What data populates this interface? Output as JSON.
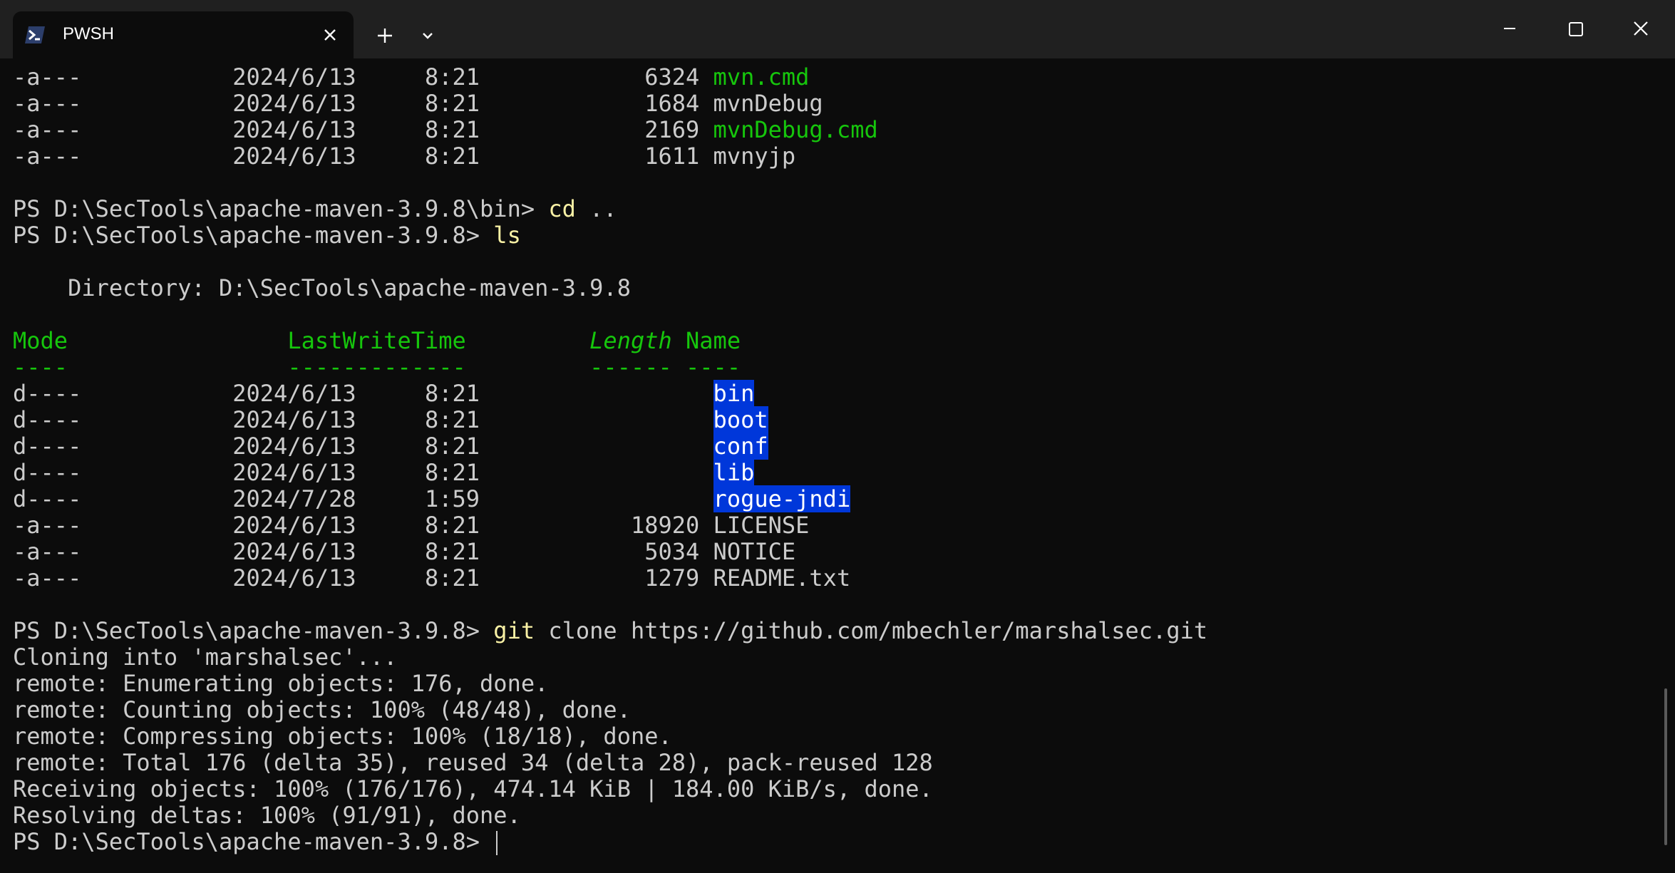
{
  "tab": {
    "title": "PWSH",
    "icon": "powershell-icon"
  },
  "titlebar": {
    "new_tab_icon": "plus-icon",
    "dropdown_icon": "chevron-down-icon",
    "minimize_icon": "minimize-icon",
    "maximize_icon": "maximize-icon",
    "close_icon": "close-icon"
  },
  "colors": {
    "background": "#0c0c0c",
    "text": "#cccccc",
    "green": "#16c60c",
    "command": "#f9f1a5",
    "dir_highlight": "#0037da"
  },
  "listing_top": [
    {
      "mode": "-a---",
      "date": "2024/6/13",
      "time": "8:21",
      "length": "6324",
      "name": "mvn.cmd"
    },
    {
      "mode": "-a---",
      "date": "2024/6/13",
      "time": "8:21",
      "length": "1684",
      "name": "mvnDebug"
    },
    {
      "mode": "-a---",
      "date": "2024/6/13",
      "time": "8:21",
      "length": "2169",
      "name": "mvnDebug.cmd"
    },
    {
      "mode": "-a---",
      "date": "2024/6/13",
      "time": "8:21",
      "length": "1611",
      "name": "mvnyjp"
    }
  ],
  "commands": {
    "cd": {
      "prompt": "PS D:\\SecTools\\apache-maven-3.9.8\\bin> ",
      "cmd": "cd",
      "args": " .."
    },
    "ls": {
      "prompt": "PS D:\\SecTools\\apache-maven-3.9.8> ",
      "cmd": "ls",
      "args": ""
    },
    "git": {
      "prompt": "PS D:\\SecTools\\apache-maven-3.9.8> ",
      "cmd": "git",
      "args": " clone https://github.com/mbechler/marshalsec.git"
    },
    "final_prompt": "PS D:\\SecTools\\apache-maven-3.9.8> "
  },
  "directory_line": "    Directory: D:\\SecTools\\apache-maven-3.9.8",
  "headers": {
    "mode": "Mode",
    "lastwrite": "LastWriteTime",
    "length": "Length",
    "name": "Name"
  },
  "separators": {
    "mode": "----",
    "lastwrite": "-------------",
    "length": "------",
    "name": "----"
  },
  "listing": [
    {
      "mode": "d----",
      "date": "2024/6/13",
      "time": "8:21",
      "length": "",
      "name": "bin"
    },
    {
      "mode": "d----",
      "date": "2024/6/13",
      "time": "8:21",
      "length": "",
      "name": "boot"
    },
    {
      "mode": "d----",
      "date": "2024/6/13",
      "time": "8:21",
      "length": "",
      "name": "conf"
    },
    {
      "mode": "d----",
      "date": "2024/6/13",
      "time": "8:21",
      "length": "",
      "name": "lib"
    },
    {
      "mode": "d----",
      "date": "2024/7/28",
      "time": "1:59",
      "length": "",
      "name": "rogue-jndi"
    },
    {
      "mode": "-a---",
      "date": "2024/6/13",
      "time": "8:21",
      "length": "18920",
      "name": "LICENSE"
    },
    {
      "mode": "-a---",
      "date": "2024/6/13",
      "time": "8:21",
      "length": "5034",
      "name": "NOTICE"
    },
    {
      "mode": "-a---",
      "date": "2024/6/13",
      "time": "8:21",
      "length": "1279",
      "name": "README.txt"
    }
  ],
  "git_output": [
    "Cloning into 'marshalsec'...",
    "remote: Enumerating objects: 176, done.",
    "remote: Counting objects: 100% (48/48), done.",
    "remote: Compressing objects: 100% (18/18), done.",
    "remote: Total 176 (delta 35), reused 34 (delta 28), pack-reused 128",
    "Receiving objects: 100% (176/176), 474.14 KiB | 184.00 KiB/s, done.",
    "Resolving deltas: 100% (91/91), done."
  ]
}
